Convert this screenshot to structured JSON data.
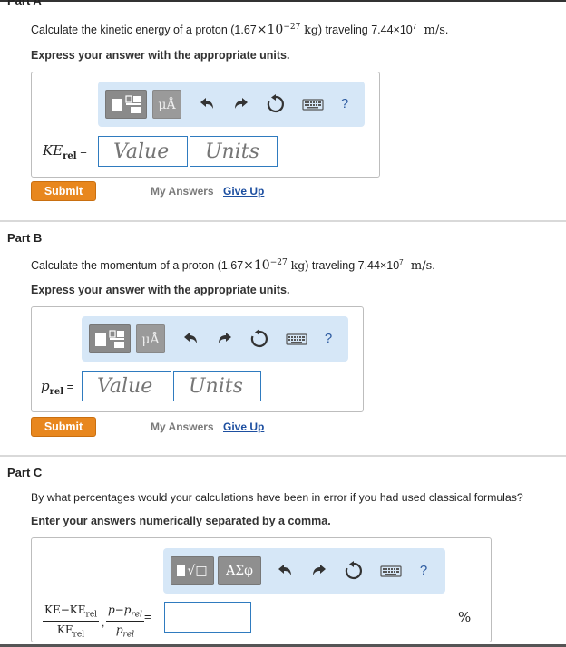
{
  "partA": {
    "title": "Part A",
    "question_pre": "Calculate the kinetic energy of a proton (1.67",
    "question_mass": "×10",
    "question_mass_exp": "−27",
    "question_mass_unit": " kg",
    "question_mid": ") traveling 7.44×10",
    "question_speed_exp": "7",
    "question_speed_unit": " m/s",
    "question_end": ".",
    "instruction": "Express your answer with the appropriate units.",
    "label_main": "KE",
    "label_sub": "rel",
    "label_eq": " =",
    "value_placeholder": "Value",
    "units_placeholder": "Units",
    "submit": "Submit",
    "my_answers": "My Answers",
    "give_up": "Give Up",
    "toolbar": {
      "mu_label": "μÅ",
      "help": "?"
    }
  },
  "partB": {
    "title": "Part B",
    "question_pre": "Calculate the momentum of a proton (1.67",
    "question_mass": "×10",
    "question_mass_exp": "−27",
    "question_mass_unit": " kg",
    "question_mid": ") traveling 7.44×10",
    "question_speed_exp": "7",
    "question_speed_unit": " m/s",
    "question_end": ".",
    "instruction": "Express your answer with the appropriate units.",
    "label_main": "p",
    "label_sub": "rel",
    "label_eq": " =",
    "value_placeholder": "Value",
    "units_placeholder": "Units",
    "submit": "Submit",
    "my_answers": "My Answers",
    "give_up": "Give Up",
    "toolbar": {
      "mu_label": "μÅ",
      "help": "?"
    }
  },
  "partC": {
    "title": "Part C",
    "question": "By what percentages would your calculations have been in error if you had used classical formulas?",
    "instruction": "Enter your answers numerically separated by a comma.",
    "frac1_num": "KE−KE",
    "frac1_num_sub": "rel",
    "frac1_den": "KE",
    "frac1_den_sub": "rel",
    "comma": ",",
    "frac2_num": "p−p",
    "frac2_num_sub": "rel",
    "frac2_den": "p",
    "frac2_den_sub": "rel",
    "eq": "=",
    "unit": "%",
    "toolbar": {
      "sqrt_label": "√□",
      "greek_label": "ΑΣφ",
      "help": "?"
    }
  },
  "colors": {
    "accent_blue": "#2f7bbf",
    "toolbar_bg": "#d6e7f7",
    "submit_orange": "#e8871e",
    "link_blue": "#1d4fa0"
  }
}
